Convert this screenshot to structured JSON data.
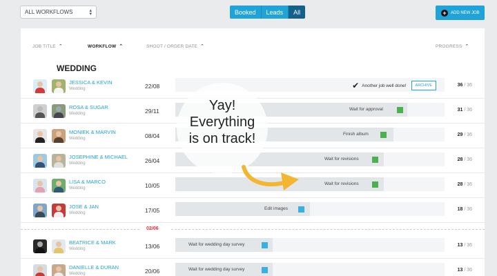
{
  "toolbar": {
    "workflow_select": "ALL WORKFLOWS",
    "filters": [
      "Booked",
      "Leads",
      "All"
    ],
    "active_filter": "All",
    "add_job_label": "ADD NEW JOB"
  },
  "columns": {
    "job_title": "JOB TITLE",
    "workflow": "WORKFLOW",
    "shoot_date": "SHOOT / ORDER DATE",
    "progress": "PROGRESS"
  },
  "group_title": "WEDDING",
  "rows": [
    {
      "names": "JESSICA & KEVIN",
      "workflow": "Wedding",
      "date": "22/08",
      "stage": "Another job well done!",
      "action": "ARCHIVE",
      "done": 36,
      "total": "/ 36",
      "progress": 1.0
    },
    {
      "names": "ROSA & SUGAR",
      "workflow": "Wedding",
      "date": "29/11",
      "stage": "Wait for approval",
      "done": 31,
      "total": "/ 36",
      "progress": 0.86
    },
    {
      "names": "MONIEK & MARVIN",
      "workflow": "Wedding",
      "date": "08/04",
      "stage": "Finish album",
      "done": 29,
      "total": "/ 36",
      "progress": 0.81
    },
    {
      "names": "JOSEPHINE & MICHAEL",
      "workflow": "Wedding",
      "date": "26/04",
      "stage": "Wait for revisions",
      "done": 28,
      "total": "/ 36",
      "progress": 0.78
    },
    {
      "names": "LISA & MARCO",
      "workflow": "Wedding",
      "date": "10/05",
      "stage": "Wait for revisions",
      "done": 28,
      "total": "/ 36",
      "progress": 0.78
    },
    {
      "names": "JOSE & JAN",
      "workflow": "Wedding",
      "date": "17/05",
      "stage": "Edit images",
      "done": 18,
      "total": "/ 36",
      "progress": 0.5
    },
    {
      "names": "BEATRICE & MARK",
      "workflow": "Wedding",
      "date": "13/06",
      "stage": "Wait for wedding day survey",
      "done": 13,
      "total": "/ 36",
      "progress": 0.36
    },
    {
      "names": "DANIELLE & DURAN",
      "workflow": "Wedding",
      "date": "20/06",
      "stage": "Wait for wedding day survey",
      "done": 13,
      "total": "/ 36",
      "progress": 0.36
    }
  ],
  "today_marker": "02/06",
  "overlay": {
    "lines": [
      "Yay!",
      "Everything",
      "is on track!"
    ]
  },
  "colors": {
    "accent": "#1fa3d8",
    "on_track": "#4caf50",
    "waiting": "#3bb0e0",
    "today": "#e0303f",
    "arrow": "#f2b632"
  }
}
